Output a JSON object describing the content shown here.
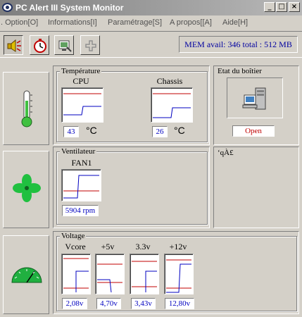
{
  "window": {
    "title": "PC Alert III System Monitor",
    "buttons": {
      "minimize": "_",
      "maximize": "□",
      "close": "×"
    }
  },
  "menu": [
    {
      "label": ". Option[O]"
    },
    {
      "label": "Informations[I]"
    },
    {
      "label": "Paramétrage[S]"
    },
    {
      "label": "A propos[[A]"
    },
    {
      "label": "Aide[H]"
    }
  ],
  "toolbar": {
    "buttons": [
      {
        "icon": "speaker-alarm-icon",
        "pressed": true
      },
      {
        "icon": "stopwatch-icon",
        "pressed": false
      },
      {
        "icon": "monitor-settings-icon",
        "pressed": false
      },
      {
        "icon": "plugin-icon",
        "pressed": false
      }
    ],
    "mem_status": "MEM avail: 346  total : 512 MB"
  },
  "temperature": {
    "group_label": "Température",
    "sensors": [
      {
        "name": "CPU",
        "value": "43",
        "unit": "°C"
      },
      {
        "name": "Chassis",
        "value": "26",
        "unit": "°C"
      }
    ]
  },
  "case_status": {
    "group_label": "Etat du boîtier",
    "status": "Open",
    "status_color": "#c00000"
  },
  "fan": {
    "group_label": "Ventilateur",
    "sensors": [
      {
        "name": "FAN1",
        "value": "5904 rpm"
      }
    ]
  },
  "extra_panel": {
    "label": "‘qÀ£"
  },
  "voltage": {
    "group_label": "Voltage",
    "sensors": [
      {
        "name": "Vcore",
        "value": "2,08v"
      },
      {
        "name": "+5v",
        "value": "4,70v"
      },
      {
        "name": "3.3v",
        "value": "3,43v"
      },
      {
        "name": "+12v",
        "value": "12,80v"
      }
    ]
  },
  "colors": {
    "graph_limit": "#c00000",
    "graph_trace": "#0000c0",
    "value_text": "#0000c0",
    "mem_text": "#0000a0"
  }
}
